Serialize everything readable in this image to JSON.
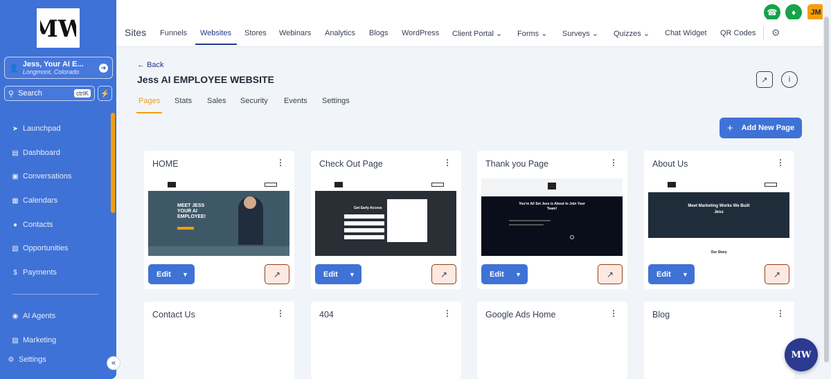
{
  "sidebar": {
    "account_name": "Jess, Your AI E...",
    "account_location": "Longmont, Colorado",
    "search_label": "Search",
    "search_shortcut": "ctrlK",
    "items": [
      {
        "label": "Launchpad",
        "icon": "rocket-icon"
      },
      {
        "label": "Dashboard",
        "icon": "chart-icon"
      },
      {
        "label": "Conversations",
        "icon": "chat-icon"
      },
      {
        "label": "Calendars",
        "icon": "calendar-icon"
      },
      {
        "label": "Contacts",
        "icon": "users-icon"
      },
      {
        "label": "Opportunities",
        "icon": "funnel-icon"
      },
      {
        "label": "Payments",
        "icon": "dollar-icon"
      }
    ],
    "items2": [
      {
        "label": "AI Agents",
        "icon": "robot-icon"
      },
      {
        "label": "Marketing",
        "icon": "cart-icon"
      },
      {
        "label": "Settings",
        "icon": "gear-icon"
      }
    ]
  },
  "header": {
    "section": "Sites",
    "tabs": [
      "Funnels",
      "Websites",
      "Stores",
      "Webinars",
      "Analytics",
      "Blogs",
      "WordPress",
      "Client Portal",
      "Forms",
      "Surveys",
      "Quizzes",
      "Chat Widget",
      "QR Codes"
    ],
    "active_tab": "Websites",
    "avatar_initials": "JM"
  },
  "page": {
    "back_label": "Back",
    "title": "Jess AI EMPLOYEE WEBSITE",
    "subtabs": [
      "Pages",
      "Stats",
      "Sales",
      "Security",
      "Events",
      "Settings"
    ],
    "active_subtab": "Pages",
    "add_button": "Add New Page",
    "edit_label": "Edit"
  },
  "cards": [
    {
      "title": "HOME",
      "preview_text": "MEET JESS YOUR AI EMPLOYEE!"
    },
    {
      "title": "Check Out Page",
      "preview_text": "Get Early Access"
    },
    {
      "title": "Thank you Page",
      "preview_text": "You're All Set Jess is About to Join Your Team!"
    },
    {
      "title": "About Us",
      "preview_text": "Meet Marketing Works We Built Jess",
      "preview_text2": "Our Story"
    },
    {
      "title": "Contact Us"
    },
    {
      "title": "404"
    },
    {
      "title": "Google Ads Home"
    },
    {
      "title": "Blog"
    }
  ],
  "colors": {
    "sidebar": "#3f72d6",
    "accent": "#f59e0b",
    "primary": "#1e3a8a"
  }
}
